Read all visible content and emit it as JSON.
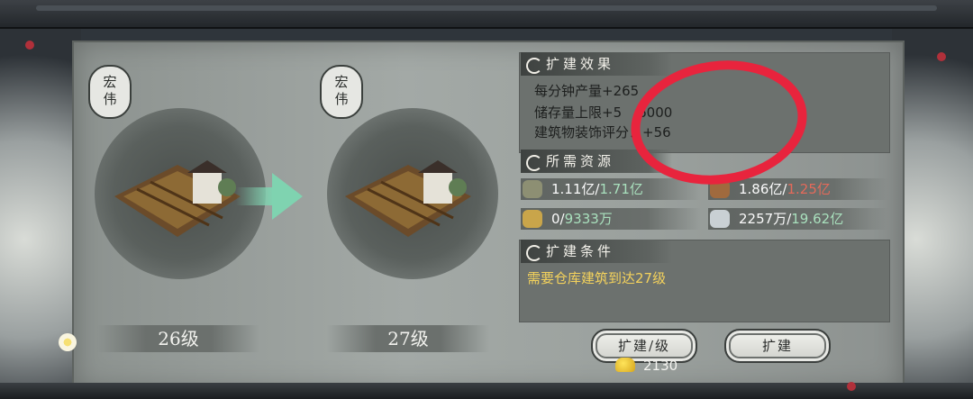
{
  "current": {
    "tag": "宏伟",
    "level": "26级"
  },
  "next": {
    "tag": "宏伟",
    "level": "27级"
  },
  "effects": {
    "title": "扩建效果",
    "lines": [
      "每分钟产量+265",
      "储存量上限+5",
      "6000",
      "建筑物装饰评分：+56"
    ]
  },
  "resources": {
    "title": "所需资源",
    "items": [
      {
        "icon": "stone-icon",
        "have": "1.11亿",
        "sep": "/",
        "need": "1.71亿",
        "need_color": "green"
      },
      {
        "icon": "wood-icon",
        "have": "1.86亿",
        "sep": "/",
        "need": "1.25亿",
        "need_color": "red"
      },
      {
        "icon": "grain-icon",
        "have": "0",
        "sep": "/",
        "need": "9333万",
        "need_color": "green"
      },
      {
        "icon": "silver-icon",
        "have": "2257万",
        "sep": "/",
        "need": "19.62亿",
        "need_color": "green"
      }
    ]
  },
  "conditions": {
    "title": "扩建条件",
    "text": "需要仓库建筑到达27级"
  },
  "buttons": {
    "upgrade_level": "扩建/级",
    "upgrade": "扩建"
  },
  "cost": {
    "amount": "2130"
  },
  "colors": {
    "annotation": "#e8243d",
    "green": "#a9e0bd",
    "red": "#e46a5a",
    "condition": "#f4d25c"
  }
}
